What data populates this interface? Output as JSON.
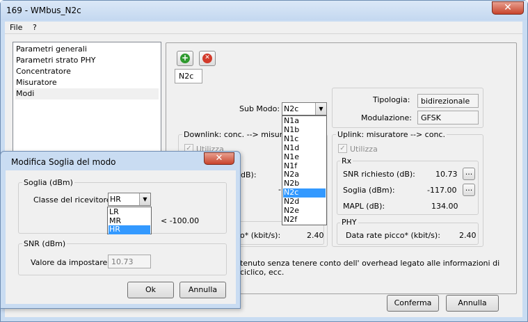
{
  "window": {
    "title": "169 - WMbus_N2c",
    "close_glyph": "✕"
  },
  "menu": [
    {
      "label": "File"
    },
    {
      "label": "?"
    }
  ],
  "nav": {
    "items": [
      {
        "label": "Parametri generali"
      },
      {
        "label": "Parametri strato PHY"
      },
      {
        "label": "Concentratore"
      },
      {
        "label": "Misuratore"
      },
      {
        "label": "Modi"
      }
    ]
  },
  "toolbar": {
    "add_glyph": "+",
    "delete_glyph": "✕",
    "add_icon": "add-icon",
    "delete_icon": "delete-icon"
  },
  "mode_tab": "N2c",
  "submode": {
    "label": "Sub Modo:",
    "value": "N2c",
    "arrow": "▼"
  },
  "submode_options": [
    "N1a",
    "N1b",
    "N1c",
    "N1d",
    "N1e",
    "N1f",
    "N2a",
    "N2b",
    "N2c",
    "N2d",
    "N2e",
    "N2f"
  ],
  "submode_selected": "N2c",
  "info": {
    "tipologia_label": "Tipologia:",
    "tipologia_value": "bidirezionale",
    "modulazione_label": "Modulazione:",
    "modulazione_value": "GFSK"
  },
  "downlink": {
    "title": "Downlink: conc. --> misuratore",
    "utilizza": "Utilizza",
    "partial_db": "dB):",
    "partial_dash": "-",
    "rate_partial": "o* (kbit/s):",
    "rate_value": "2.40"
  },
  "uplink": {
    "title": "Uplink: misuratore --> conc.",
    "utilizza": "Utilizza",
    "rx_title": "Rx",
    "snr_label": "SNR richiesto (dB):",
    "snr_value": "10.73",
    "soglia_label": "Soglia (dBm):",
    "soglia_value": "-117.00",
    "mapl_label": "MAPL (dB):",
    "mapl_value": "134.00",
    "phy_title": "PHY",
    "rate_label": "Data rate picco* (kbit/s):",
    "rate_value": "2.40",
    "dots": "..."
  },
  "footnote": {
    "line1": "tenuto senza tenere conto dell' overhead legato alle informazioni di",
    "line2": "ciclico, ecc."
  },
  "buttons": {
    "confirm": "Conferma",
    "cancel": "Annulla"
  },
  "dialog": {
    "title": "Modifica Soglia del modo",
    "close_glyph": "✕",
    "soglia_group": "Soglia (dBm)",
    "classe_label": "Classe del ricevitore:",
    "classe_value": "HR",
    "classe_options": [
      "LR",
      "MR",
      "HR"
    ],
    "classe_selected": "HR",
    "threshold_text": "< -100.00",
    "snr_group": "SNR (dBm)",
    "valore_label": "Valore da impostare:",
    "valore_value": "10.73",
    "ok": "Ok",
    "cancel": "Annulla"
  },
  "colors": {
    "frame": "#c9dcf2",
    "client": "#f0f0f0",
    "selection": "#3399ff",
    "close_red": "#c8442c"
  }
}
